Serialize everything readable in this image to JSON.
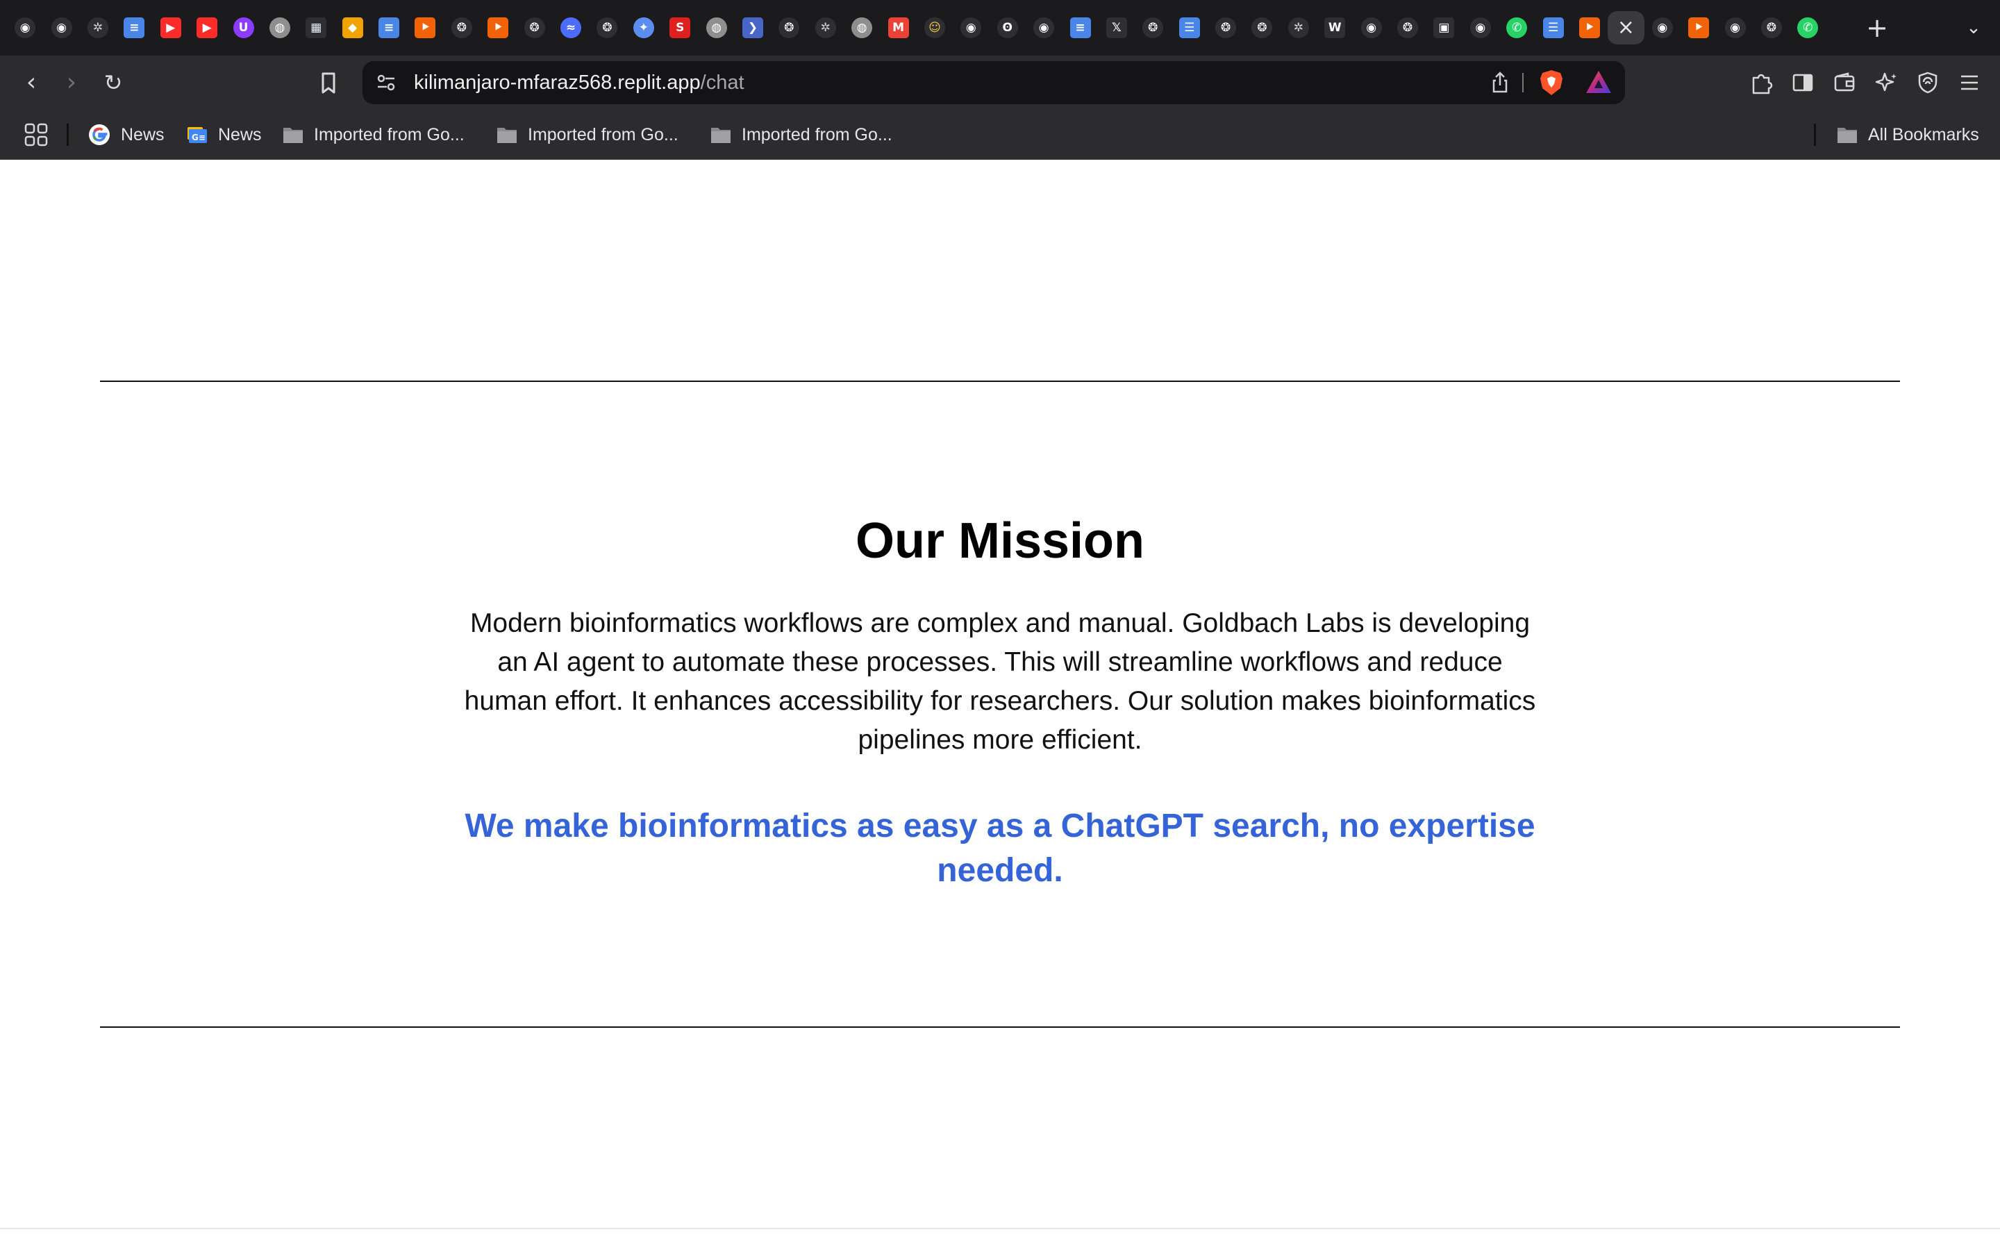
{
  "browser": {
    "tabs": [
      {
        "icon": "github-icon",
        "color": "#ffffff",
        "glyph": "◉",
        "shape": "circle"
      },
      {
        "icon": "github-icon",
        "color": "#ffffff",
        "glyph": "◉",
        "shape": "circle"
      },
      {
        "icon": "bug-icon",
        "color": "#cfcfcf",
        "glyph": "✲",
        "shape": "circle"
      },
      {
        "icon": "google-docs-icon",
        "color": "#4a86e8",
        "glyph": "≡",
        "shape": "square"
      },
      {
        "icon": "youtube-icon",
        "color": "#ff2a2a",
        "glyph": "▶",
        "shape": "square"
      },
      {
        "icon": "youtube-icon",
        "color": "#ff2a2a",
        "glyph": "▶",
        "shape": "square"
      },
      {
        "icon": "purple-u-icon",
        "color": "#8c3cff",
        "glyph": "U",
        "shape": "circle"
      },
      {
        "icon": "globe-icon",
        "color": "#8e8e8e",
        "glyph": "◍",
        "shape": "circle"
      },
      {
        "icon": "pdf-icon",
        "color": "#e8eef8",
        "glyph": "▦",
        "shape": "square"
      },
      {
        "icon": "box-icon",
        "color": "#f0a400",
        "glyph": "◆",
        "shape": "square"
      },
      {
        "icon": "google-docs-icon",
        "color": "#4a86e8",
        "glyph": "≡",
        "shape": "square"
      },
      {
        "icon": "replit-icon",
        "color": "#f26207",
        "glyph": "⯈",
        "shape": "square"
      },
      {
        "icon": "openai-icon",
        "color": "#ffffff",
        "glyph": "❂",
        "shape": "circle"
      },
      {
        "icon": "replit-icon",
        "color": "#f26207",
        "glyph": "⯈",
        "shape": "square"
      },
      {
        "icon": "openai-icon",
        "color": "#ffffff",
        "glyph": "❂",
        "shape": "circle"
      },
      {
        "icon": "deepseek-icon",
        "color": "#4d6bfe",
        "glyph": "≈",
        "shape": "circle"
      },
      {
        "icon": "openai-icon",
        "color": "#ffffff",
        "glyph": "❂",
        "shape": "circle"
      },
      {
        "icon": "gemini-icon",
        "color": "#5b8def",
        "glyph": "✦",
        "shape": "circle"
      },
      {
        "icon": "scribd-icon",
        "color": "#e0201f",
        "glyph": "S",
        "shape": "square"
      },
      {
        "icon": "globe-icon",
        "color": "#8e8e8e",
        "glyph": "◍",
        "shape": "circle"
      },
      {
        "icon": "blue-arrow-icon",
        "color": "#4a65c8",
        "glyph": "❯",
        "shape": "square"
      },
      {
        "icon": "openai-icon",
        "color": "#ffffff",
        "glyph": "❂",
        "shape": "circle"
      },
      {
        "icon": "bug-icon",
        "color": "#cfcfcf",
        "glyph": "✲",
        "shape": "circle"
      },
      {
        "icon": "globe-icon",
        "color": "#8e8e8e",
        "glyph": "◍",
        "shape": "circle"
      },
      {
        "icon": "gmail-icon",
        "color": "#ea4335",
        "glyph": "M",
        "shape": "square"
      },
      {
        "icon": "huggingface-icon",
        "color": "#ffcc3d",
        "glyph": "☺",
        "shape": "circle"
      },
      {
        "icon": "github-icon",
        "color": "#ffffff",
        "glyph": "◉",
        "shape": "circle"
      },
      {
        "icon": "ollama-icon",
        "color": "#ffffff",
        "glyph": "ʘ",
        "shape": "circle"
      },
      {
        "icon": "github-icon",
        "color": "#ffffff",
        "glyph": "◉",
        "shape": "circle"
      },
      {
        "icon": "google-docs-icon",
        "color": "#4a86e8",
        "glyph": "≡",
        "shape": "square"
      },
      {
        "icon": "x-icon",
        "color": "#ffffff",
        "glyph": "𝕏",
        "shape": "square"
      },
      {
        "icon": "openai-icon",
        "color": "#ffffff",
        "glyph": "❂",
        "shape": "circle"
      },
      {
        "icon": "lines-icon",
        "color": "#4a86e8",
        "glyph": "☰",
        "shape": "square"
      },
      {
        "icon": "openai-icon",
        "color": "#ffffff",
        "glyph": "❂",
        "shape": "circle"
      },
      {
        "icon": "openai-icon",
        "color": "#ffffff",
        "glyph": "❂",
        "shape": "circle"
      },
      {
        "icon": "bug-icon",
        "color": "#cfcfcf",
        "glyph": "✲",
        "shape": "circle"
      },
      {
        "icon": "wikipedia-icon",
        "color": "#ffffff",
        "glyph": "W",
        "shape": "square"
      },
      {
        "icon": "github-icon",
        "color": "#ffffff",
        "glyph": "◉",
        "shape": "circle"
      },
      {
        "icon": "openai-icon",
        "color": "#ffffff",
        "glyph": "❂",
        "shape": "circle"
      },
      {
        "icon": "square-app-icon",
        "color": "#ffffff",
        "glyph": "▣",
        "shape": "square"
      },
      {
        "icon": "github-icon",
        "color": "#ffffff",
        "glyph": "◉",
        "shape": "circle"
      },
      {
        "icon": "whatsapp-icon",
        "color": "#25d366",
        "glyph": "✆",
        "shape": "circle"
      },
      {
        "icon": "lines-icon",
        "color": "#4a86e8",
        "glyph": "☰",
        "shape": "square"
      },
      {
        "icon": "replit-icon",
        "color": "#f26207",
        "glyph": "⯈",
        "shape": "square"
      },
      {
        "icon": "close-icon",
        "color": "#e8e8e8",
        "glyph": "×",
        "shape": "circle",
        "active": true
      },
      {
        "icon": "github-icon",
        "color": "#ffffff",
        "glyph": "◉",
        "shape": "circle"
      },
      {
        "icon": "replit-icon",
        "color": "#f26207",
        "glyph": "⯈",
        "shape": "square"
      },
      {
        "icon": "github-icon",
        "color": "#ffffff",
        "glyph": "◉",
        "shape": "circle"
      },
      {
        "icon": "openai-icon",
        "color": "#ffffff",
        "glyph": "❂",
        "shape": "circle"
      },
      {
        "icon": "whatsapp-icon",
        "color": "#25d366",
        "glyph": "✆",
        "shape": "circle"
      }
    ],
    "new_tab_glyph": "+",
    "tab_overflow_glyph": "⌄",
    "url_host": "kilimanjaro-mfaraz568.replit.app",
    "url_path": "/chat",
    "back_glyph": "‹",
    "forward_glyph": "›",
    "reload_glyph": "↻",
    "bookmarks": [
      {
        "label": "News",
        "icon": "google-icon"
      },
      {
        "label": "News",
        "icon": "google-news-icon"
      },
      {
        "label": "Imported from Go...",
        "icon": "folder-icon"
      },
      {
        "label": "Imported from Go...",
        "icon": "folder-icon"
      },
      {
        "label": "Imported from Go...",
        "icon": "folder-icon"
      }
    ],
    "all_bookmarks_label": "All Bookmarks"
  },
  "page": {
    "mission_title": "Our Mission",
    "mission_body": "Modern bioinformatics workflows are complex and manual. Goldbach Labs is developing an AI agent to automate these processes. This will streamline workflows and reduce human effort. It enhances accessibility for researchers. Our solution makes bioinformatics pipelines more efficient.",
    "mission_tagline": "We make bioinformatics as easy as a ChatGPT search, no expertise needed.",
    "accent_color": "#3563d8"
  }
}
